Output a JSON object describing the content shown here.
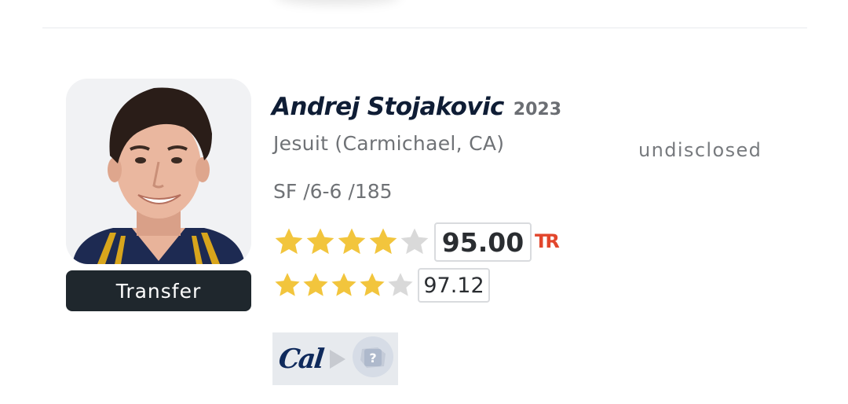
{
  "player": {
    "name": "Andrej Stojakovic",
    "class_year": "2023",
    "school": "Jesuit (Carmichael, CA)",
    "position": "SF",
    "height": "6-6",
    "weight": "185",
    "measurables": "SF /6-6 /185",
    "status_badge": "Transfer",
    "destination_status": "undisclosed"
  },
  "ratings": {
    "primary": {
      "stars": 4,
      "max_stars": 5,
      "score": "95.00",
      "source_icon": "tr-logo"
    },
    "secondary": {
      "stars": 4,
      "max_stars": 5,
      "score": "97.12"
    }
  },
  "transfer_path": {
    "from_logo": "Cal",
    "arrow_icon": "play-arrow-icon",
    "to_icon": "question-mark-school-icon",
    "to_label": "?"
  },
  "colors": {
    "star_filled": "#f2c53d",
    "star_empty": "#d9d9d9",
    "name": "#0f1d35",
    "badge_bg": "#1f272d",
    "tr_accent": "#e2462c",
    "movement_bg": "#e7eaee"
  }
}
